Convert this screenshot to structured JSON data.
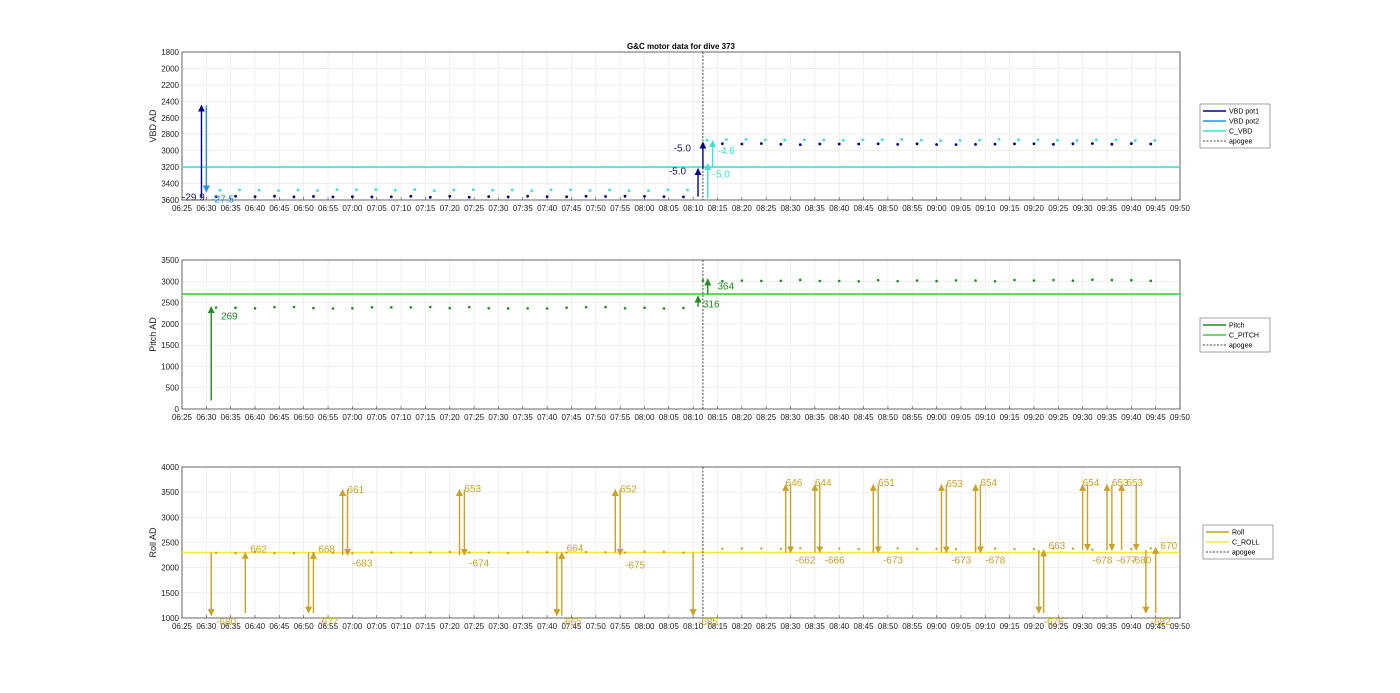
{
  "chart_data": {
    "type": "line",
    "title": "G&C motor data for dive 373",
    "x_ticks": [
      "06:25",
      "06:30",
      "06:35",
      "06:40",
      "06:45",
      "06:50",
      "06:55",
      "07:00",
      "07:05",
      "07:10",
      "07:15",
      "07:20",
      "07:25",
      "07:30",
      "07:35",
      "07:40",
      "07:45",
      "07:50",
      "07:55",
      "08:00",
      "08:05",
      "08:10",
      "08:15",
      "08:20",
      "08:25",
      "08:30",
      "08:35",
      "08:40",
      "08:45",
      "08:50",
      "08:55",
      "09:00",
      "09:05",
      "09:10",
      "09:15",
      "09:20",
      "09:25",
      "09:30",
      "09:35",
      "09:40",
      "09:45",
      "09:50"
    ],
    "apogee": "08:12",
    "colors": {
      "vbd1": "#00008b",
      "vbd2": "#1e90ff",
      "cvbd": "#40e0d0",
      "pitch": "#228b22",
      "cpitch": "#44cc44",
      "roll": "#c9a227",
      "croll": "#f5e642",
      "apogee": "#444444"
    },
    "panels": [
      {
        "id": "vbd",
        "ylabel": "VBD AD",
        "ylim": [
          1800,
          3600
        ],
        "y_reversed": true,
        "y_ticks": [
          "1800",
          "2000",
          "2200",
          "2400",
          "2600",
          "2800",
          "3000",
          "3200",
          "3400",
          "3600"
        ],
        "legend": [
          "VBD pot1",
          "VBD pot2",
          "C_VBD",
          "apogee"
        ],
        "c_value": 3200,
        "moves": [
          {
            "t": "06:29",
            "from": 3580,
            "to": 2450,
            "color": "vbd1",
            "label": "-29.9",
            "lx": "06:25",
            "ly": 3560
          },
          {
            "t": "06:30",
            "from": 2450,
            "to": 3500,
            "color": "vbd2",
            "label": "-27.5",
            "lx": "06:31",
            "ly": 3580
          },
          {
            "t": "08:11",
            "from": 3560,
            "to": 3220,
            "color": "vbd1",
            "label": "-5.0",
            "lx": "08:05",
            "ly": 3240
          },
          {
            "t": "08:12",
            "from": 3220,
            "to": 2900,
            "color": "vbd1",
            "label": "-5.0",
            "lx": "08:06",
            "ly": 2960
          },
          {
            "t": "08:13",
            "from": 3580,
            "to": 3160,
            "color": "cvbd",
            "label": "-5.0",
            "lx": "08:14",
            "ly": 3280
          },
          {
            "t": "08:14",
            "from": 3200,
            "to": 2880,
            "color": "cvbd",
            "label": "-4.6",
            "lx": "08:15",
            "ly": 2990
          }
        ]
      },
      {
        "id": "pitch",
        "ylabel": "Pitch AD",
        "ylim": [
          0,
          3500
        ],
        "y_reversed": false,
        "y_ticks": [
          "0",
          "500",
          "1000",
          "1500",
          "2000",
          "2500",
          "3000",
          "3500"
        ],
        "legend": [
          "Pitch",
          "C_PITCH",
          "apogee"
        ],
        "c_value": 2700,
        "moves": [
          {
            "t": "06:31",
            "from": 200,
            "to": 2400,
            "color": "pitch",
            "label": "269",
            "lx": "06:33",
            "ly": 2200
          },
          {
            "t": "08:11",
            "from": 2400,
            "to": 2650,
            "color": "pitch",
            "label": "316",
            "lx": "08:12",
            "ly": 2480
          },
          {
            "t": "08:13",
            "from": 2700,
            "to": 3050,
            "color": "pitch",
            "label": "364",
            "lx": "08:15",
            "ly": 2900
          }
        ]
      },
      {
        "id": "roll",
        "ylabel": "Roll AD",
        "ylim": [
          1000,
          4000
        ],
        "y_reversed": false,
        "y_ticks": [
          "1000",
          "1500",
          "2000",
          "2500",
          "3000",
          "3500",
          "4000"
        ],
        "legend": [
          "Roll",
          "C_ROLL",
          "apogee"
        ],
        "c_value": 2300,
        "moves": [
          {
            "t": "06:31",
            "from": 2300,
            "to": 1050,
            "color": "roll",
            "label": "-680",
            "lx": "06:32",
            "ly": 940
          },
          {
            "t": "06:38",
            "from": 1100,
            "to": 2300,
            "color": "roll",
            "label": "662",
            "lx": "06:39",
            "ly": 2380
          },
          {
            "t": "06:51",
            "from": 2300,
            "to": 1100,
            "color": "roll",
            "label": "-677",
            "lx": "06:53",
            "ly": 940
          },
          {
            "t": "06:52",
            "from": 1100,
            "to": 2300,
            "color": "roll",
            "label": "668",
            "lx": "06:53",
            "ly": 2380
          },
          {
            "t": "06:58",
            "from": 2250,
            "to": 3550,
            "color": "roll",
            "label": "661",
            "lx": "06:59",
            "ly": 3560
          },
          {
            "t": "06:59",
            "from": 3550,
            "to": 2250,
            "color": "roll",
            "label": "-683",
            "lx": "07:00",
            "ly": 2100
          },
          {
            "t": "07:22",
            "from": 2250,
            "to": 3550,
            "color": "roll",
            "label": "653",
            "lx": "07:23",
            "ly": 3580
          },
          {
            "t": "07:23",
            "from": 3550,
            "to": 2250,
            "color": "roll",
            "label": "-674",
            "lx": "07:24",
            "ly": 2100
          },
          {
            "t": "07:42",
            "from": 2300,
            "to": 1050,
            "color": "roll",
            "label": "-665",
            "lx": "07:43",
            "ly": 940
          },
          {
            "t": "07:43",
            "from": 1050,
            "to": 2300,
            "color": "roll",
            "label": "664",
            "lx": "07:44",
            "ly": 2400
          },
          {
            "t": "07:54",
            "from": 2300,
            "to": 3550,
            "color": "roll",
            "label": "652",
            "lx": "07:55",
            "ly": 3570
          },
          {
            "t": "07:55",
            "from": 3550,
            "to": 2250,
            "color": "roll",
            "label": "-675",
            "lx": "07:56",
            "ly": 2060
          },
          {
            "t": "08:10",
            "from": 2300,
            "to": 1050,
            "color": "roll",
            "label": "-685",
            "lx": "08:11",
            "ly": 940
          },
          {
            "t": "08:29",
            "from": 2300,
            "to": 3650,
            "color": "roll",
            "label": "646",
            "lx": "08:29",
            "ly": 3700
          },
          {
            "t": "08:30",
            "from": 3650,
            "to": 2300,
            "color": "roll",
            "label": "-662",
            "lx": "08:31",
            "ly": 2160
          },
          {
            "t": "08:35",
            "from": 2300,
            "to": 3650,
            "color": "roll",
            "label": "644",
            "lx": "08:35",
            "ly": 3700
          },
          {
            "t": "08:36",
            "from": 3650,
            "to": 2300,
            "color": "roll",
            "label": "-666",
            "lx": "08:37",
            "ly": 2160
          },
          {
            "t": "08:47",
            "from": 2300,
            "to": 3650,
            "color": "roll",
            "label": "651",
            "lx": "08:48",
            "ly": 3700
          },
          {
            "t": "08:48",
            "from": 3650,
            "to": 2300,
            "color": "roll",
            "label": "-673",
            "lx": "08:49",
            "ly": 2160
          },
          {
            "t": "09:01",
            "from": 2300,
            "to": 3650,
            "color": "roll",
            "label": "653",
            "lx": "09:02",
            "ly": 3680
          },
          {
            "t": "09:02",
            "from": 3650,
            "to": 2300,
            "color": "roll",
            "label": "-673",
            "lx": "09:03",
            "ly": 2160
          },
          {
            "t": "09:08",
            "from": 2300,
            "to": 3650,
            "color": "roll",
            "label": "654",
            "lx": "09:09",
            "ly": 3700
          },
          {
            "t": "09:09",
            "from": 3650,
            "to": 2300,
            "color": "roll",
            "label": "-678",
            "lx": "09:10",
            "ly": 2160
          },
          {
            "t": "09:21",
            "from": 2350,
            "to": 1100,
            "color": "roll",
            "label": "-676",
            "lx": "09:22",
            "ly": 940
          },
          {
            "t": "09:22",
            "from": 1100,
            "to": 2350,
            "color": "roll",
            "label": "663",
            "lx": "09:23",
            "ly": 2450
          },
          {
            "t": "09:30",
            "from": 2350,
            "to": 3650,
            "color": "roll",
            "label": "654",
            "lx": "09:30",
            "ly": 3700
          },
          {
            "t": "09:31",
            "from": 3650,
            "to": 2350,
            "color": "roll",
            "label": "-678",
            "lx": "09:32",
            "ly": 2160
          },
          {
            "t": "09:35",
            "from": 2350,
            "to": 3650,
            "color": "roll",
            "label": "653",
            "lx": "09:36",
            "ly": 3700
          },
          {
            "t": "09:36",
            "from": 3650,
            "to": 2350,
            "color": "roll",
            "label": "-677",
            "lx": "09:37",
            "ly": 2160
          },
          {
            "t": "09:38",
            "from": 2350,
            "to": 3650,
            "color": "roll",
            "label": "653",
            "lx": "09:39",
            "ly": 3700
          },
          {
            "t": "09:41",
            "from": 3650,
            "to": 2350,
            "color": "roll",
            "label": "-680",
            "lx": "09:40",
            "ly": 2160
          },
          {
            "t": "09:43",
            "from": 2350,
            "to": 1100,
            "color": "roll",
            "label": "-682",
            "lx": "09:44",
            "ly": 940
          },
          {
            "t": "09:45",
            "from": 1100,
            "to": 2400,
            "color": "roll",
            "label": "670",
            "lx": "09:46",
            "ly": 2450
          }
        ]
      }
    ]
  }
}
